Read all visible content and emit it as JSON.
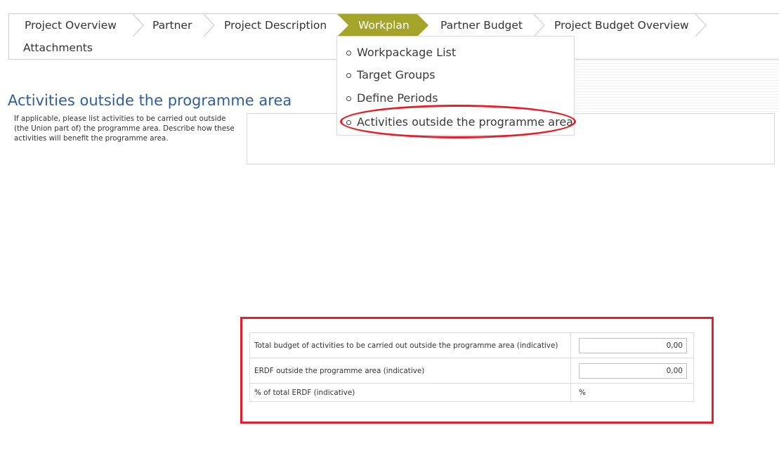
{
  "tabs": {
    "project_overview": "Project Overview",
    "partner": "Partner",
    "project_description": "Project Description",
    "workplan": "Workplan",
    "partner_budget": "Partner Budget",
    "project_budget_overview": "Project Budget Overview",
    "attachments": "Attachments"
  },
  "colors": {
    "active_tab": "#a4a42a",
    "title": "#2d5f9c",
    "highlight": "#e21f2a"
  },
  "workplan_menu": [
    {
      "label": "Workpackage List"
    },
    {
      "label": "Target Groups"
    },
    {
      "label": "Define Periods"
    },
    {
      "label": "Activities outside the programme area"
    }
  ],
  "section": {
    "title": "Activities outside the programme area",
    "description": "If applicable, please list activities to be carried out outside (the Union part of) the programme area. Describe how these activities will benefit the programme area."
  },
  "budget": {
    "total_label": "Total budget of activities to be carried out outside the programme area (indicative)",
    "total_value": "0,00",
    "erdf_label": "ERDF outside the programme area (indicative)",
    "erdf_value": "0,00",
    "pct_label": "% of total ERDF (indicative)",
    "pct_value": "%"
  }
}
